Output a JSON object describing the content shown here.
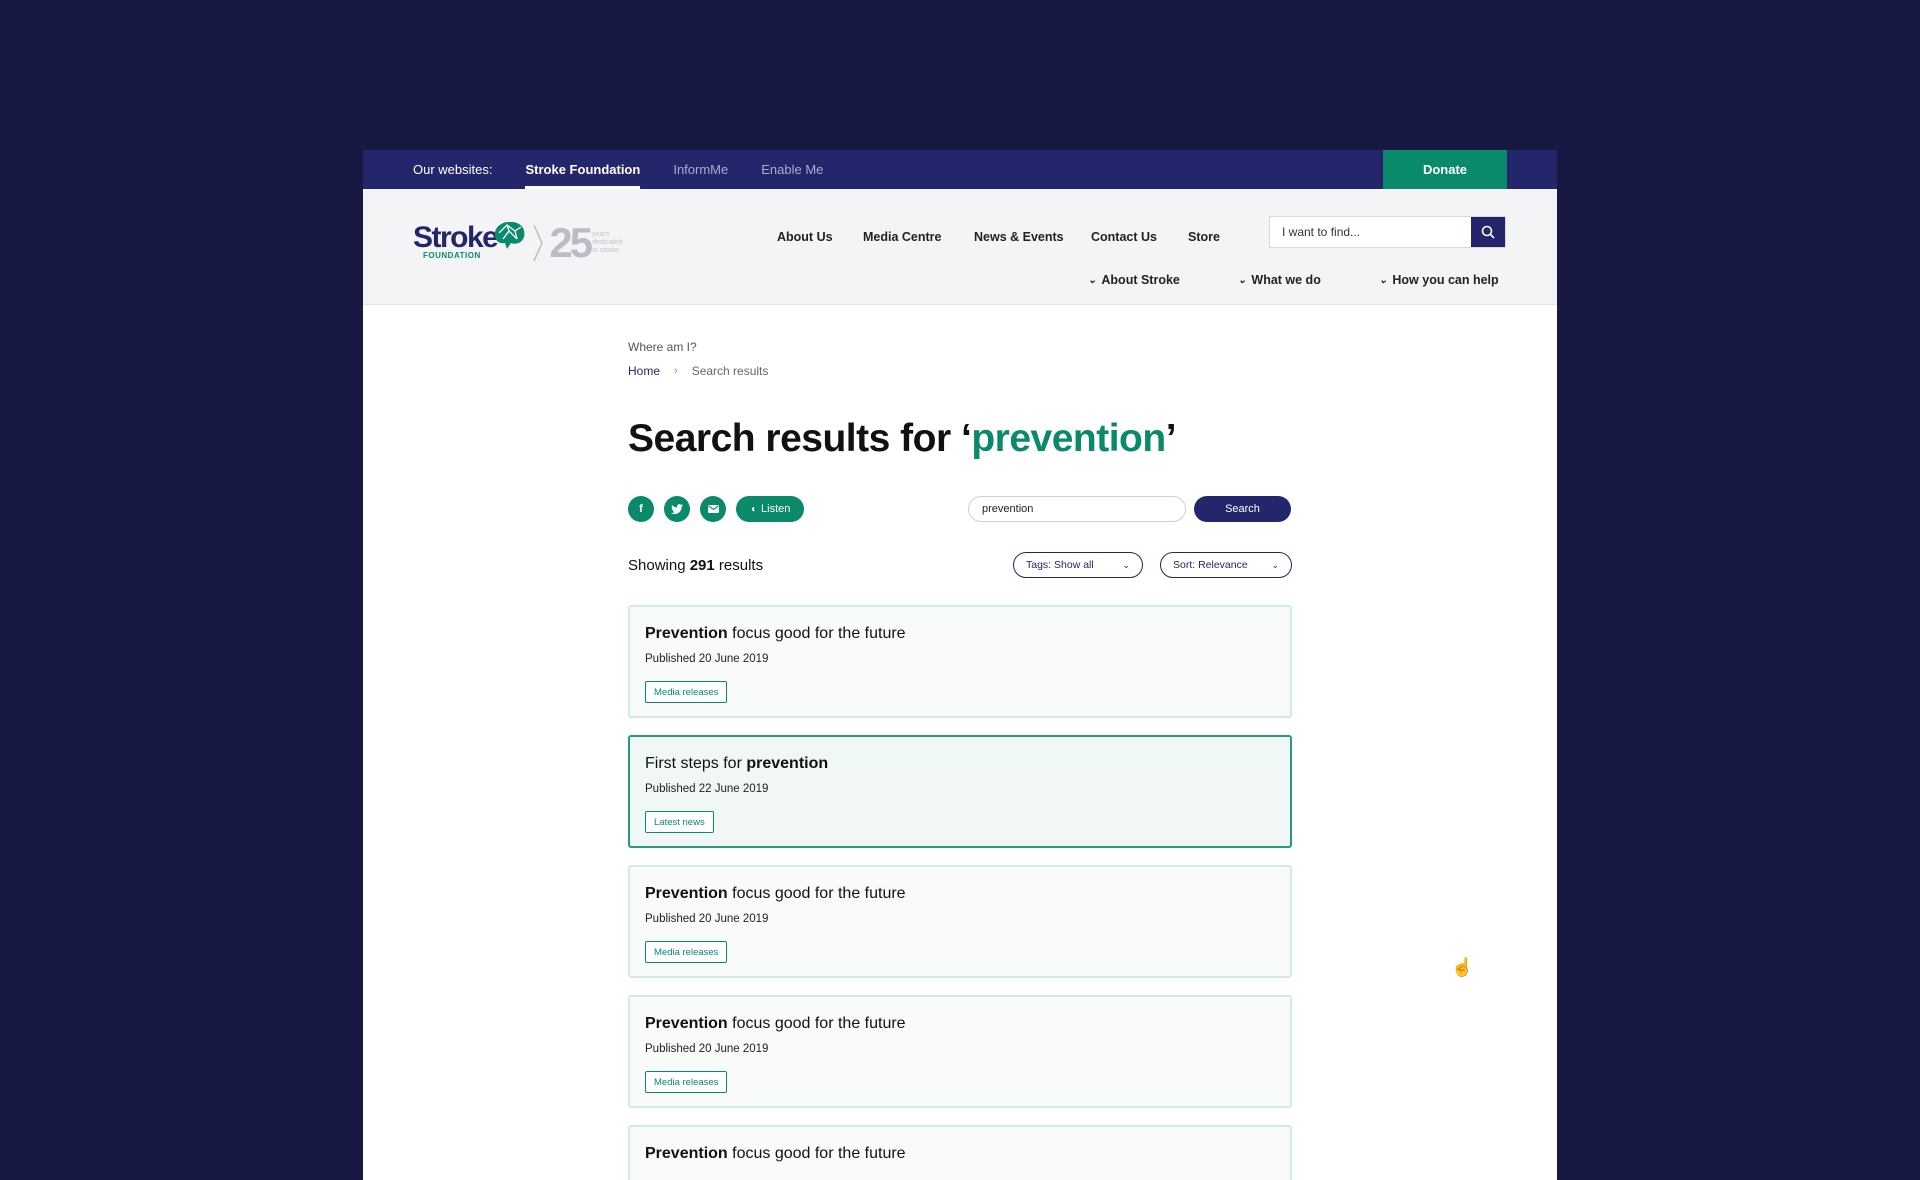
{
  "topbar": {
    "label": "Our websites:",
    "sites": [
      "Stroke Foundation",
      "InformMe",
      "Enable Me"
    ],
    "donate": "Donate"
  },
  "logo": {
    "word": "Stroke",
    "sub": "FOUNDATION",
    "number": "25",
    "tagline": [
      "years",
      "dedicated",
      "to stroke"
    ]
  },
  "nav": {
    "primary": [
      "About Us",
      "Media Centre",
      "News & Events",
      "Contact Us",
      "Store"
    ],
    "secondary": [
      "About Stroke",
      "What we do",
      "How you can help"
    ],
    "search_placeholder": "I want to find..."
  },
  "breadcrumb": {
    "label": "Where am I?",
    "home": "Home",
    "current": "Search results"
  },
  "page": {
    "title_prefix": "Search results for ‘",
    "query": "prevention",
    "title_suffix": "’",
    "listen": "Listen",
    "search_value": "prevention",
    "search_button": "Search",
    "showing_prefix": "Showing ",
    "count": "291",
    "showing_suffix": " results",
    "tags_filter": "Tags: Show all",
    "sort": "Sort: Relevance"
  },
  "share_icons": [
    "facebook-icon",
    "twitter-icon",
    "email-icon",
    "listen-icon"
  ],
  "results": [
    {
      "bold": "Prevention",
      "rest": " focus good for the future",
      "bold_first": true,
      "published": "Published 20 June 2019",
      "tag": "Media releases"
    },
    {
      "bold": "prevention",
      "rest": "First steps for ",
      "bold_first": false,
      "published": "Published 22 June 2019",
      "tag": "Latest news"
    },
    {
      "bold": "Prevention",
      "rest": " focus good for the future",
      "bold_first": true,
      "published": "Published 20 June 2019",
      "tag": "Media releases"
    },
    {
      "bold": "Prevention",
      "rest": " focus good for the future",
      "bold_first": true,
      "published": "Published 20 June 2019",
      "tag": "Media releases"
    },
    {
      "bold": "Prevention",
      "rest": " focus good for the future",
      "bold_first": true,
      "published": "",
      "tag": ""
    }
  ],
  "colors": {
    "background": "#171943",
    "navy": "#24266b",
    "green": "#0a8a6b"
  }
}
